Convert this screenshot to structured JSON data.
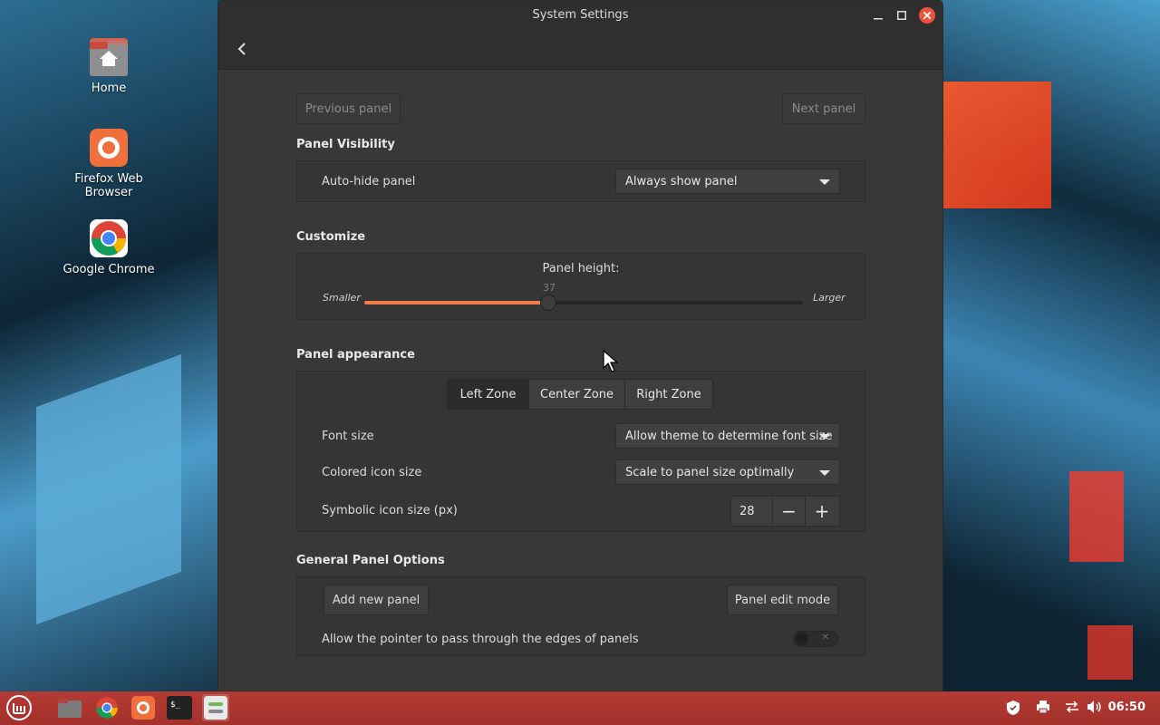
{
  "desktop": {
    "icons": [
      {
        "label": "Home",
        "icon": "home-folder-icon"
      },
      {
        "label": "Firefox Web Browser",
        "icon": "firefox-icon"
      },
      {
        "label": "Google Chrome",
        "icon": "chrome-icon"
      }
    ]
  },
  "window": {
    "title": "System Settings",
    "buttons": {
      "minimize": "minimize-icon",
      "maximize": "maximize-icon",
      "close": "close-icon"
    },
    "back_icon": "back-arrow-icon"
  },
  "nav": {
    "previous": "Previous panel",
    "next": "Next panel"
  },
  "visibility": {
    "title": "Panel Visibility",
    "autohide_label": "Auto-hide panel",
    "autohide_value": "Always show panel"
  },
  "customize": {
    "title": "Customize",
    "height_label": "Panel height:",
    "height_value": "37",
    "height_fraction": 0.42,
    "smaller": "Smaller",
    "larger": "Larger"
  },
  "appearance": {
    "title": "Panel appearance",
    "zones": [
      "Left Zone",
      "Center Zone",
      "Right Zone"
    ],
    "active_zone": "Left Zone",
    "font_size_label": "Font size",
    "font_size_value": "Allow theme to determine font size",
    "colored_icon_label": "Colored icon size",
    "colored_icon_value": "Scale to panel size optimally",
    "symbolic_icon_label": "Symbolic icon size (px)",
    "symbolic_icon_value": "28",
    "minus": "−",
    "plus": "+"
  },
  "general": {
    "title": "General Panel Options",
    "add_panel": "Add new panel",
    "edit_mode": "Panel edit mode",
    "pointer_label": "Allow the pointer to pass through the edges of panels",
    "pointer_enabled": false
  },
  "taskbar": {
    "menu_icon": "mint-menu-icon",
    "launchers": [
      "files-icon",
      "chrome-icon",
      "firefox-icon",
      "terminal-icon",
      "settings-icon"
    ],
    "tray": [
      "shield-icon",
      "printer-icon",
      "network-icon",
      "volume-icon"
    ],
    "clock": "06:50"
  },
  "colors": {
    "accent": "#f17d48",
    "panel": "#a4302b",
    "window": "#383838"
  }
}
